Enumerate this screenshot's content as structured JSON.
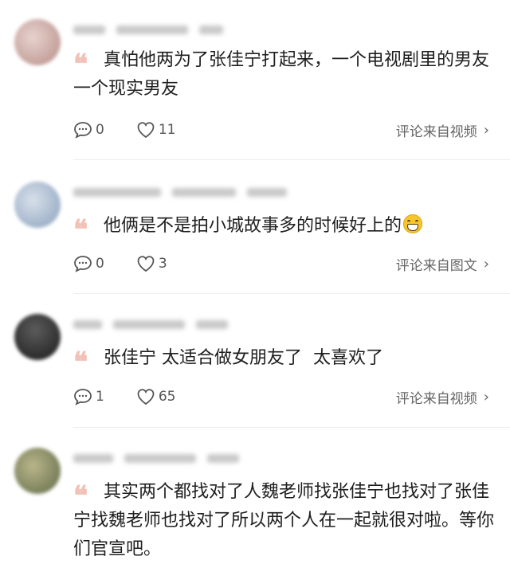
{
  "comments": [
    {
      "text": "真怕他两为了张佳宁打起来，一个电视剧里的男友一个现实男友",
      "reply_count": "0",
      "like_count": "11",
      "source": "评论来自视频",
      "avatar_color": "#c9a6a2",
      "has_emoji": false
    },
    {
      "text": "他俩是不是拍小城故事多的时候好上的",
      "reply_count": "0",
      "like_count": "3",
      "source": "评论来自图文",
      "avatar_color": "#9fb2c9",
      "has_emoji": true,
      "emoji_icon": "grinning-face-icon"
    },
    {
      "text": "张佳宁 太适合做女朋友了  太喜欢了",
      "reply_count": "1",
      "like_count": "65",
      "source": "评论来自视频",
      "avatar_color": "#2b2b2b",
      "has_emoji": false
    },
    {
      "text": "其实两个都找对了人魏老师找张佳宁也找对了张佳宁找魏老师也找对了所以两个人在一起就很对啦。等你们官宣吧。",
      "reply_count": "",
      "like_count": "",
      "source": "",
      "avatar_color": "#8a8f6a",
      "has_emoji": false
    }
  ],
  "icons": {
    "reply": "comment-bubble-icon",
    "like": "heart-icon",
    "quote": "quote-mark-icon",
    "chevron": "chevron-right-icon"
  },
  "colors": {
    "quote_mark": "#f2c2b8",
    "text": "#1e1e1e",
    "secondary": "#666666"
  }
}
